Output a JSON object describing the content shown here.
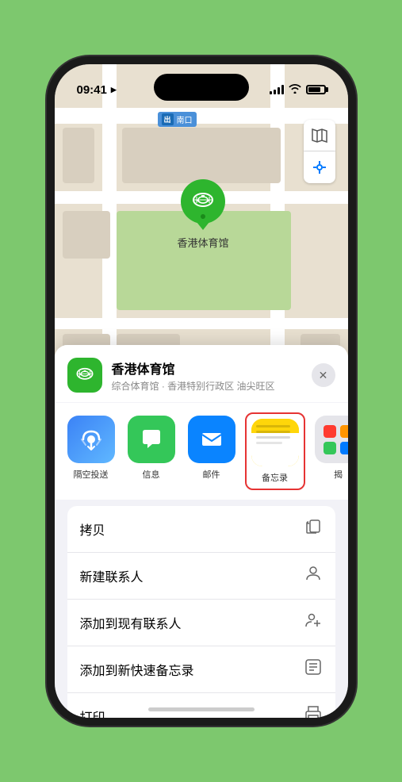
{
  "phone": {
    "time": "09:41",
    "location_indicator": "▶"
  },
  "map": {
    "label": "南口",
    "label_prefix": "出",
    "zoom_icon": "🗺",
    "location_icon": "➤",
    "venue_name_on_map": "香港体育馆"
  },
  "share_sheet": {
    "venue_name": "香港体育馆",
    "venue_subtitle": "综合体育馆 · 香港特别行政区 油尖旺区",
    "close_label": "✕",
    "share_items": [
      {
        "id": "airdrop",
        "label": "隔空投送"
      },
      {
        "id": "messages",
        "label": "信息"
      },
      {
        "id": "mail",
        "label": "邮件"
      },
      {
        "id": "notes",
        "label": "备忘录"
      },
      {
        "id": "more",
        "label": "揭"
      }
    ],
    "actions": [
      {
        "id": "copy",
        "label": "拷贝",
        "icon": "copy"
      },
      {
        "id": "new-contact",
        "label": "新建联系人",
        "icon": "person"
      },
      {
        "id": "add-contact",
        "label": "添加到现有联系人",
        "icon": "person-plus"
      },
      {
        "id": "quick-note",
        "label": "添加到新快速备忘录",
        "icon": "note"
      },
      {
        "id": "print",
        "label": "打印",
        "icon": "print"
      }
    ]
  }
}
